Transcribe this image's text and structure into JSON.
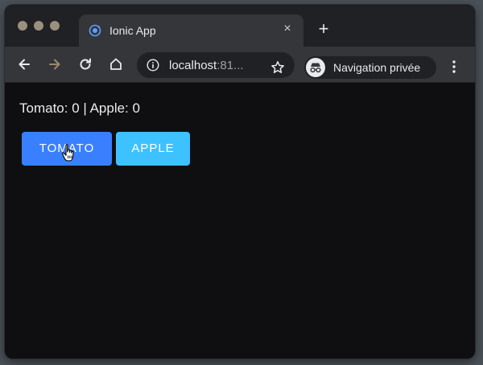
{
  "browser": {
    "tab": {
      "title": "Ionic App",
      "close": "×"
    },
    "new_tab": "+",
    "address_bar": {
      "host": "localhost",
      "host_rest": ":81..."
    },
    "incognito_label": "Navigation privée"
  },
  "page": {
    "counter_text": "Tomato: 0 | Apple: 0",
    "tomato_button": "TOMATO",
    "apple_button": "APPLE"
  },
  "colors": {
    "tomato_button": "#3880ff",
    "apple_button": "#3dc2ff",
    "page_background": "#0f0f12",
    "toolbar": "#35363a"
  },
  "icons": [
    "ionic-logo-icon",
    "close-icon",
    "plus-icon",
    "back-icon",
    "forward-icon",
    "reload-icon",
    "home-icon",
    "info-icon",
    "star-icon",
    "incognito-icon",
    "kebab-menu-icon",
    "hand-cursor-icon"
  ]
}
